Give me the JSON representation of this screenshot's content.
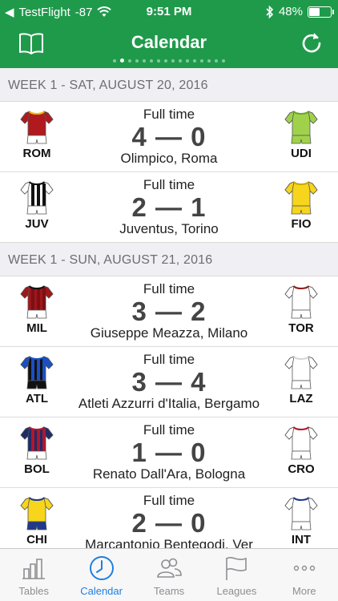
{
  "status_bar": {
    "carrier": "TestFlight",
    "signal": "-87",
    "time": "9:51 PM",
    "battery": "48%",
    "battery_level": 0.48
  },
  "navbar": {
    "title": "Calendar",
    "left_icon": "book-icon",
    "right_icon": "refresh-icon",
    "page_count": 16,
    "active_page": 1
  },
  "sections": [
    {
      "header": "WEEK 1 - SAT, AUGUST 20, 2016",
      "matches": [
        {
          "status": "Full time",
          "score": "4 — 0",
          "venue": "Olimpico, Roma",
          "home": {
            "abbr": "ROM",
            "kit": {
              "shirt": "#b0191e",
              "sleeve": "#b0191e",
              "trim": "#f2b800",
              "shorts": "#ffffff",
              "stripes": null
            }
          },
          "away": {
            "abbr": "UDI",
            "kit": {
              "shirt": "#9fd24a",
              "sleeve": "#9fd24a",
              "trim": "#6aa52a",
              "shorts": "#9fd24a",
              "stripes": null
            }
          }
        },
        {
          "status": "Full time",
          "score": "2 — 1",
          "venue": "Juventus, Torino",
          "home": {
            "abbr": "JUV",
            "kit": {
              "shirt": "#ffffff",
              "sleeve": "#ffffff",
              "trim": "#111111",
              "shorts": "#ffffff",
              "stripes": "#111111"
            }
          },
          "away": {
            "abbr": "FIO",
            "kit": {
              "shirt": "#f6d51c",
              "sleeve": "#f6d51c",
              "trim": "#c9a800",
              "shorts": "#f6d51c",
              "stripes": null
            }
          }
        }
      ]
    },
    {
      "header": "WEEK 1 - SUN, AUGUST 21, 2016",
      "matches": [
        {
          "status": "Full time",
          "score": "3 — 2",
          "venue": "Giuseppe Meazza, Milano",
          "home": {
            "abbr": "MIL",
            "kit": {
              "shirt": "#a0161b",
              "sleeve": "#a0161b",
              "trim": "#111111",
              "shorts": "#ffffff",
              "stripes": "#7a1014"
            }
          },
          "away": {
            "abbr": "TOR",
            "kit": {
              "shirt": "#ffffff",
              "sleeve": "#ffffff",
              "trim": "#8b1a1a",
              "shorts": "#ffffff",
              "stripes": null
            }
          }
        },
        {
          "status": "Full time",
          "score": "3 — 4",
          "venue": "Atleti Azzurri d'Italia, Bergamo",
          "home": {
            "abbr": "ATL",
            "kit": {
              "shirt": "#111111",
              "sleeve": "#1a4fc4",
              "trim": "#1a4fc4",
              "shorts": "#111111",
              "stripes": "#1a4fc4"
            }
          },
          "away": {
            "abbr": "LAZ",
            "kit": {
              "shirt": "#ffffff",
              "sleeve": "#ffffff",
              "trim": "#d6d6d6",
              "shorts": "#ffffff",
              "stripes": null
            }
          }
        },
        {
          "status": "Full time",
          "score": "1 — 0",
          "venue": "Renato Dall'Ara, Bologna",
          "home": {
            "abbr": "BOL",
            "kit": {
              "shirt": "#1e2c6a",
              "sleeve": "#1e2c6a",
              "trim": "#b3162b",
              "shorts": "#ffffff",
              "stripes": "#b3162b"
            }
          },
          "away": {
            "abbr": "CRO",
            "kit": {
              "shirt": "#ffffff",
              "sleeve": "#ffffff",
              "trim": "#b3162b",
              "shorts": "#ffffff",
              "stripes": null
            }
          }
        },
        {
          "status": "Full time",
          "score": "2 — 0",
          "venue": "Marcantonio Bentegodi, Ver",
          "home": {
            "abbr": "CHI",
            "kit": {
              "shirt": "#f6d51c",
              "sleeve": "#f6d51c",
              "trim": "#1e3a8a",
              "shorts": "#1e3a8a",
              "stripes": null
            }
          },
          "away": {
            "abbr": "INT",
            "kit": {
              "shirt": "#ffffff",
              "sleeve": "#ffffff",
              "trim": "#1e3a8a",
              "shorts": "#ffffff",
              "stripes": null
            }
          }
        }
      ]
    }
  ],
  "tab_bar": {
    "items": [
      {
        "label": "Tables",
        "icon": "tables-icon",
        "active": false
      },
      {
        "label": "Calendar",
        "icon": "clock-icon",
        "active": true
      },
      {
        "label": "Teams",
        "icon": "teams-icon",
        "active": false
      },
      {
        "label": "Leagues",
        "icon": "flag-icon",
        "active": false
      },
      {
        "label": "More",
        "icon": "more-icon",
        "active": false
      }
    ]
  },
  "colors": {
    "accent": "#1f9a4b",
    "tab_active": "#1f7fe0",
    "tab_inactive": "#8e8e93"
  }
}
